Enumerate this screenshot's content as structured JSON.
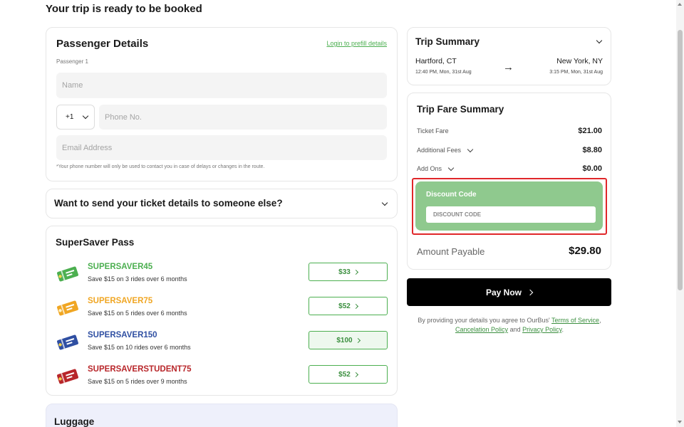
{
  "page": {
    "title": "Your trip is ready to be booked"
  },
  "passenger": {
    "heading": "Passenger Details",
    "prefill_link": "Login to prefill details",
    "passenger_label": "Passenger 1",
    "name_placeholder": "Name",
    "country_code": "+1",
    "phone_placeholder": "Phone No.",
    "email_placeholder": "Email Address",
    "note": "*Your phone number will only be used to contact you in case of delays or changes in the route."
  },
  "send_ticket": {
    "label": "Want to send your ticket details to someone else?"
  },
  "supersaver": {
    "heading": "SuperSaver Pass",
    "passes": [
      {
        "name": "SUPERSAVER45",
        "desc": "Save $15 on 3 rides over 6 months",
        "price": "$33",
        "color": "#4caf50",
        "selected": false
      },
      {
        "name": "SUPERSAVER75",
        "desc": "Save $15 on 5 rides over 6 months",
        "price": "$52",
        "color": "#f0a623",
        "selected": false
      },
      {
        "name": "SUPERSAVER150",
        "desc": "Save $15 on 10 rides over 6 months",
        "price": "$100",
        "color": "#2f4fa2",
        "selected": true
      },
      {
        "name": "SUPERSAVERSTUDENT75",
        "desc": "Save $15 on 5 rides over 9 months",
        "price": "$52",
        "color": "#b8262a",
        "selected": false
      }
    ]
  },
  "luggage": {
    "heading": "Luggage"
  },
  "trip_summary": {
    "heading": "Trip Summary",
    "from_city": "Hartford, CT",
    "from_time": "12:40 PM, Mon, 31st Aug",
    "to_city": "New York, NY",
    "to_time": "3:15 PM, Mon, 31st Aug",
    "arrow": "→"
  },
  "fare_summary": {
    "heading": "Trip Fare Summary",
    "rows": [
      {
        "label": "Ticket Fare",
        "value": "$21.00"
      },
      {
        "label": "Additional Fees",
        "value": "$8.80"
      },
      {
        "label": "Add Ons",
        "value": "$0.00"
      }
    ],
    "discount_title": "Discount Code",
    "discount_placeholder": "DISCOUNT CODE",
    "amount_label": "Amount Payable",
    "amount_value": "$29.80"
  },
  "pay": {
    "label": "Pay Now"
  },
  "terms": {
    "prefix": "By providing your details you agree to OurBus' ",
    "terms_link": "Terms of Service",
    "sep1": ", ",
    "cancel_link": "Cancelation Policy",
    "sep2": " and ",
    "privacy_link": "Privacy Policy",
    "suffix": "."
  },
  "colors": {
    "accent_green": "#4caf50",
    "discount_bg": "#8fc98e",
    "highlight_red": "#e0272a",
    "luggage_bg": "#eef0fb"
  },
  "icons": [
    "chevron-down-icon",
    "arrow-right-icon",
    "ticket-icon",
    "chevron-right-icon"
  ]
}
